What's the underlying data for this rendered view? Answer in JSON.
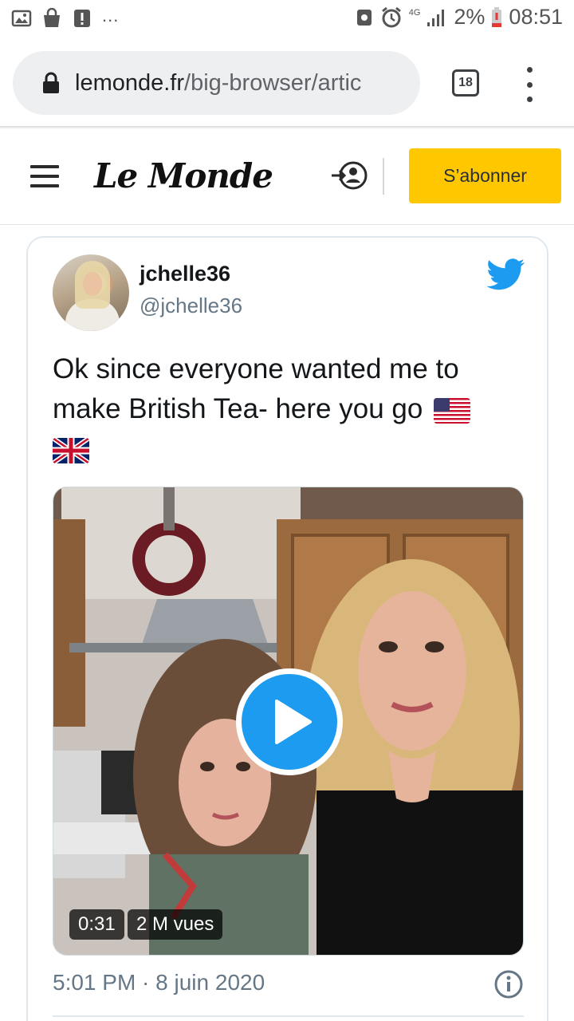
{
  "status_bar": {
    "left_icons": [
      "image-icon",
      "shopping-bag-icon",
      "alert-icon"
    ],
    "overflow": "...",
    "network": "4G",
    "battery": "2%",
    "time": "08:51"
  },
  "browser": {
    "url_host": "lemonde.fr",
    "url_path": "/big-browser/artic",
    "tab_count": "18"
  },
  "site_header": {
    "logo": "Le Monde",
    "subscribe_label": "S’abonner",
    "colors": {
      "subscribe_bg": "#ffc700"
    }
  },
  "tweet": {
    "author_name": "jchelle36",
    "author_handle": "@jchelle36",
    "text": "Ok since everyone wanted me to make British Tea- here you go",
    "flags": [
      "us-flag-icon",
      "uk-flag-icon"
    ],
    "video": {
      "duration": "0:31",
      "views": "2 M vues"
    },
    "timestamp": "5:01 PM · 8 juin 2020",
    "colors": {
      "twitter_blue": "#1d9bf0",
      "handle_gray": "#657786"
    }
  }
}
